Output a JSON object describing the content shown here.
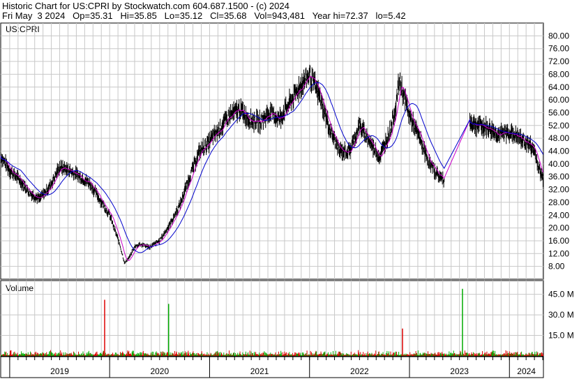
{
  "header": {
    "line1": "Historic Chart for US:CPRI by Stockwatch.com 604.687.1500 - (c) 2024",
    "line2": "Fri May  3 2024   Op=35.31   Hi=35.85   Lo=35.12   Cl=35.68   Vol=943,481   Year hi=72.37   lo=5.42"
  },
  "colors": {
    "price": "#000000",
    "ma_short": "#cc00cc",
    "ma_long": "#0000cc",
    "vol_up": "#00aa00",
    "vol_down": "#dd0000",
    "grid": "#c8c8c8"
  },
  "chart_data": [
    {
      "type": "line",
      "title": "US:CPRI",
      "ylim": [
        4,
        84
      ],
      "y_ticks": [
        "80.00",
        "76.00",
        "72.00",
        "68.00",
        "64.00",
        "60.00",
        "56.00",
        "52.00",
        "48.00",
        "44.00",
        "40.00",
        "36.00",
        "32.00",
        "28.00",
        "24.00",
        "20.00",
        "16.00",
        "12.00",
        "8.00"
      ],
      "x_ticks": [
        "2019",
        "2020",
        "2021",
        "2022",
        "2023",
        "2024"
      ],
      "grid": true,
      "x": [
        2018.9,
        2019.0,
        2019.1,
        2019.2,
        2019.3,
        2019.4,
        2019.5,
        2019.6,
        2019.7,
        2019.8,
        2019.9,
        2020.0,
        2020.1,
        2020.15,
        2020.2,
        2020.25,
        2020.3,
        2020.4,
        2020.5,
        2020.6,
        2020.7,
        2020.8,
        2020.9,
        2021.0,
        2021.1,
        2021.2,
        2021.3,
        2021.4,
        2021.5,
        2021.6,
        2021.7,
        2021.8,
        2021.9,
        2022.0,
        2022.1,
        2022.2,
        2022.3,
        2022.4,
        2022.5,
        2022.6,
        2022.7,
        2022.8,
        2022.85,
        2022.9,
        2023.0,
        2023.1,
        2023.2,
        2023.3,
        2023.35,
        2023.5,
        2023.6,
        2023.7,
        2023.8,
        2023.9,
        2024.0,
        2024.1,
        2024.2,
        2024.25,
        2024.3,
        2024.34
      ],
      "series": [
        {
          "values": [
            43,
            38,
            35,
            31,
            29,
            33,
            39,
            38,
            36,
            34,
            29,
            24,
            15,
            9,
            11,
            14,
            15,
            14,
            16,
            21,
            27,
            36,
            44,
            47,
            51,
            55,
            57,
            54,
            53,
            56,
            54,
            59,
            64,
            68,
            61,
            51,
            44,
            44,
            52,
            47,
            42,
            50,
            56,
            66,
            55,
            48,
            40,
            36,
            35,
            null,
            53,
            52,
            51,
            49,
            50,
            48,
            46,
            44,
            38,
            35
          ]
        }
      ]
    },
    {
      "type": "bar",
      "title": "Volume",
      "ylim": [
        0,
        55
      ],
      "y_ticks": [
        "45.0 M",
        "30.0 M",
        "15.0 M"
      ],
      "spikes": [
        {
          "x": 2019.95,
          "value": 41,
          "dir": "down"
        },
        {
          "x": 2020.59,
          "value": 38,
          "dir": "up"
        },
        {
          "x": 2022.93,
          "value": 20,
          "dir": "down"
        },
        {
          "x": 2023.53,
          "value": 49,
          "dir": "up"
        }
      ]
    }
  ]
}
